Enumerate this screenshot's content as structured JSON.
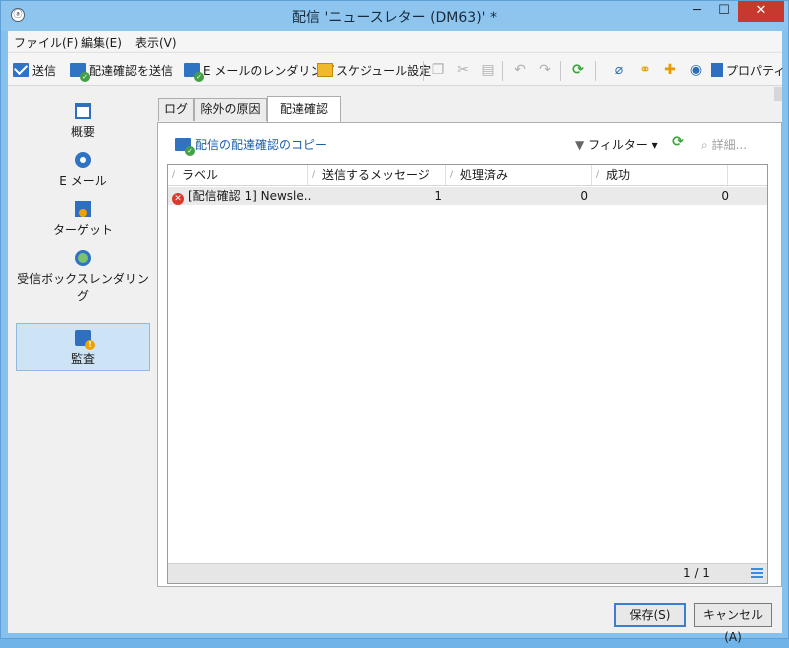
{
  "window": {
    "title": "配信 'ニュースレター (DM63)' *",
    "app_icon": "ⓐ",
    "minimize_glyph": "─",
    "maximize_glyph": "☐",
    "close_glyph": "✕"
  },
  "menubar": [
    "ファイル(F)",
    "編集(E)",
    "表示(V)"
  ],
  "toolbar": {
    "send": "送信",
    "send_proof": "配達確認を送信",
    "email_rendering": "E メールのレンダリング",
    "schedule": "スケジュール設定",
    "properties": "プロパティ"
  },
  "sidebar": {
    "items": [
      {
        "label": "概要",
        "icon": "window-icon"
      },
      {
        "label": "E メール",
        "icon": "email-icon"
      },
      {
        "label": "ターゲット",
        "icon": "target-icon"
      },
      {
        "label": "受信ボックスレンダリング",
        "icon": "globe-icon"
      },
      {
        "label": "監査",
        "icon": "audit-icon",
        "selected": true
      }
    ]
  },
  "tabs": [
    {
      "label": "ログ"
    },
    {
      "label": "除外の原因"
    },
    {
      "label": "配達確認",
      "active": true
    }
  ],
  "panel": {
    "copy_proof": "配信の配達確認のコピー",
    "filter": "フィルター",
    "filter_arrow": "▾",
    "details": "詳細..."
  },
  "grid": {
    "columns": [
      "ラベル",
      "送信するメッセージ",
      "処理済み",
      "成功"
    ],
    "rows": [
      {
        "status": "error",
        "label": "[配信確認 1] Newsle..",
        "messages": "1",
        "processed": "0",
        "success": "0"
      }
    ],
    "page_indicator": "1 / 1"
  },
  "buttons": {
    "save": "保存(S)",
    "cancel": "キャンセル(A)"
  }
}
